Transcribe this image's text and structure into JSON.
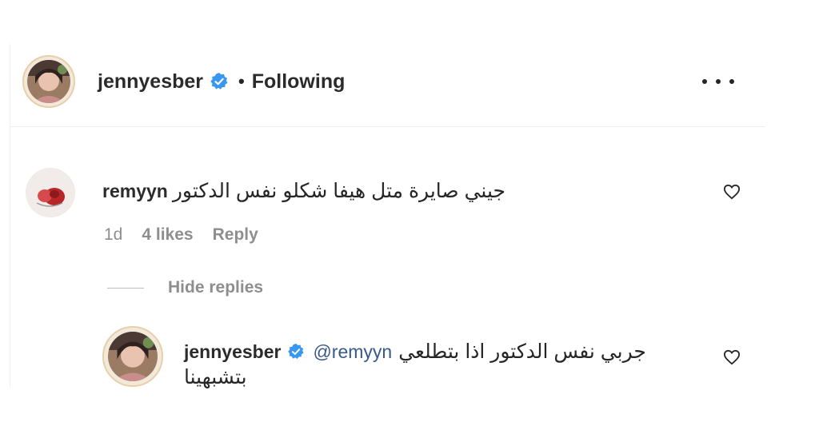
{
  "post_header": {
    "username": "jennyesber",
    "separator": "•",
    "follow_status": "Following",
    "verified_icon": "verified-badge-icon",
    "more_icon": "more-options-icon",
    "accent_color": "#3897f0"
  },
  "comment": {
    "username": "remyyn",
    "text": "جيني صايرة متل هيفا شكلو نفس الدكتور",
    "age": "1d",
    "likes": "4 likes",
    "reply_label": "Reply",
    "like_icon": "heart-icon"
  },
  "replies_toggle": {
    "label": "Hide replies"
  },
  "reply": {
    "username": "jennyesber",
    "mention": "@remyyn",
    "text_line1": "جربي نفس الدكتور اذا بتطلعي",
    "text_line2": "بتشبهينا",
    "like_icon": "heart-icon"
  },
  "colors": {
    "text": "#262626",
    "muted": "#8e8e8e",
    "mention": "#375a8a",
    "verified": "#3897f0"
  }
}
